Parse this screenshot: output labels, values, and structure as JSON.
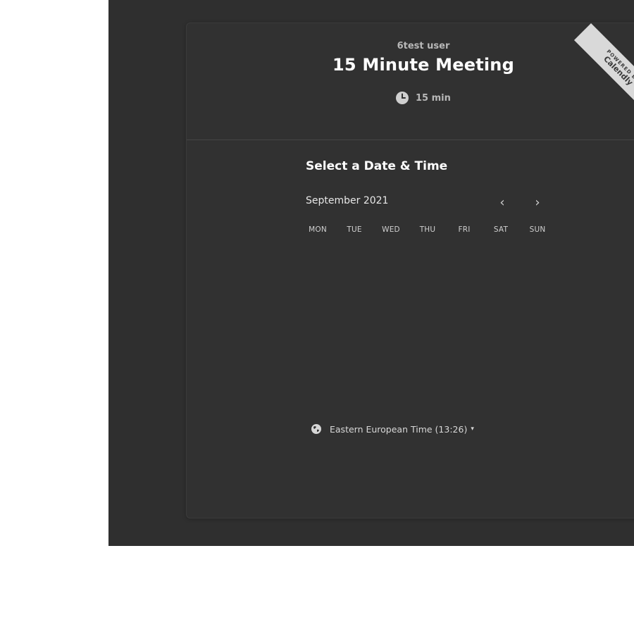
{
  "event": {
    "host": "6test user",
    "title": "15 Minute Meeting",
    "duration": "15 min"
  },
  "ribbon": {
    "small_text": "POWERED BY",
    "big_text": "Calendly"
  },
  "calendar": {
    "heading": "Select a Date & Time",
    "month_label": "September 2021",
    "prev_label": "‹",
    "next_label": "›",
    "weekdays": [
      "MON",
      "TUE",
      "WED",
      "THU",
      "FRI",
      "SAT",
      "SUN"
    ]
  },
  "timezone": {
    "label": "Eastern European Time (13:26)",
    "caret": "▾"
  },
  "icons": {
    "clock": "clock-icon",
    "globe": "globe-icon",
    "chevron_left": "chevron-left-icon",
    "chevron_right": "chevron-right-icon"
  }
}
